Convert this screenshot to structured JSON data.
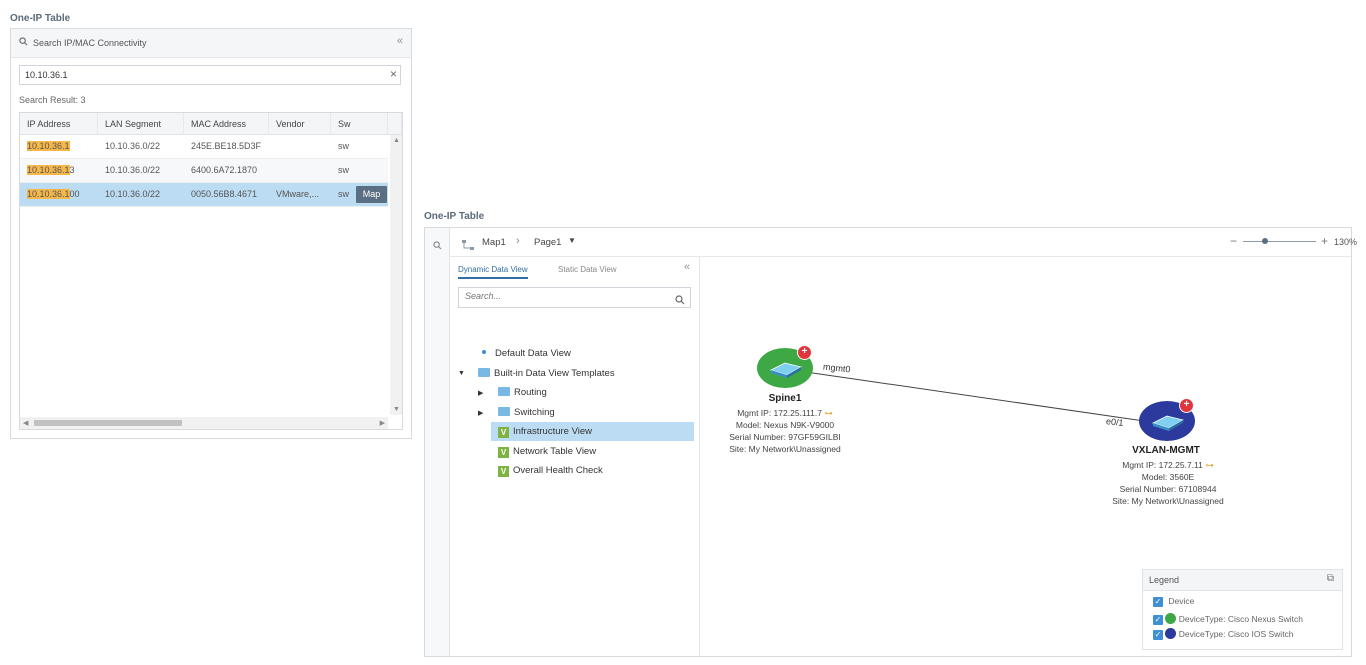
{
  "left_window": {
    "title": "One-IP Table",
    "search_header": "Search IP/MAC Connectivity",
    "search_value": "10.10.36.1",
    "result_label": "Search Result:",
    "result_count": "3",
    "columns": [
      "IP Address",
      "LAN Segment",
      "MAC Address",
      "Vendor",
      "Sw"
    ],
    "rows": [
      {
        "ip_hl": "10.10.36.1",
        "ip_rest": "",
        "lan": "10.10.36.0/22",
        "mac": "245E.BE18.5D3F",
        "vendor": "",
        "sw": "sw"
      },
      {
        "ip_hl": "10.10.36.1",
        "ip_rest": "3",
        "lan": "10.10.36.0/22",
        "mac": "6400.6A72.1870",
        "vendor": "",
        "sw": "sw"
      },
      {
        "ip_hl": "10.10.36.1",
        "ip_rest": "00",
        "lan": "10.10.36.0/22",
        "mac": "0050.56B8.4671",
        "vendor": "VMware,...",
        "sw": "sw"
      }
    ],
    "map_button": "Map",
    "highlight_color": "#f6b74a",
    "selected_row_color": "#bcdcf3"
  },
  "right_window": {
    "title": "One-IP Table",
    "breadcrumb": [
      "Map1",
      "Page1"
    ],
    "zoom": "130%",
    "zoom_fraction": 0.3,
    "tabs": [
      "Dynamic Data View",
      "Static Data View"
    ],
    "tree_search_placeholder": "Search...",
    "tree": {
      "default_view": "Default Data View",
      "builtin": "Built-in Data View Templates",
      "routing": "Routing",
      "switching": "Switching",
      "infra": "Infrastructure View",
      "network_table": "Network Table View",
      "health": "Overall Health Check"
    },
    "badge_letter": "V",
    "devices": {
      "spine": {
        "name": "Spine1",
        "mgmt_ip": "Mgmt IP: 172.25.111.7",
        "model": "Model: Nexus N9K-V9000",
        "serial": "Serial Number: 97GF59GILBI",
        "site": "Site: My Network\\Unassigned",
        "color": "#3ea845"
      },
      "vxlan": {
        "name": "VXLAN-MGMT",
        "mgmt_ip": "Mgmt IP: 172.25.7.11",
        "model": "Model: 3560E",
        "serial": "Serial Number: 67108944",
        "site": "Site: My Network\\Unassigned",
        "color": "#2b3a9c"
      }
    },
    "links": {
      "spine_port": "mgmt0",
      "vxlan_port": "e0/1"
    },
    "legend": {
      "title": "Legend",
      "device": "Device",
      "type1": "DeviceType: Cisco Nexus Switch",
      "type2": "DeviceType: Cisco IOS Switch"
    }
  }
}
